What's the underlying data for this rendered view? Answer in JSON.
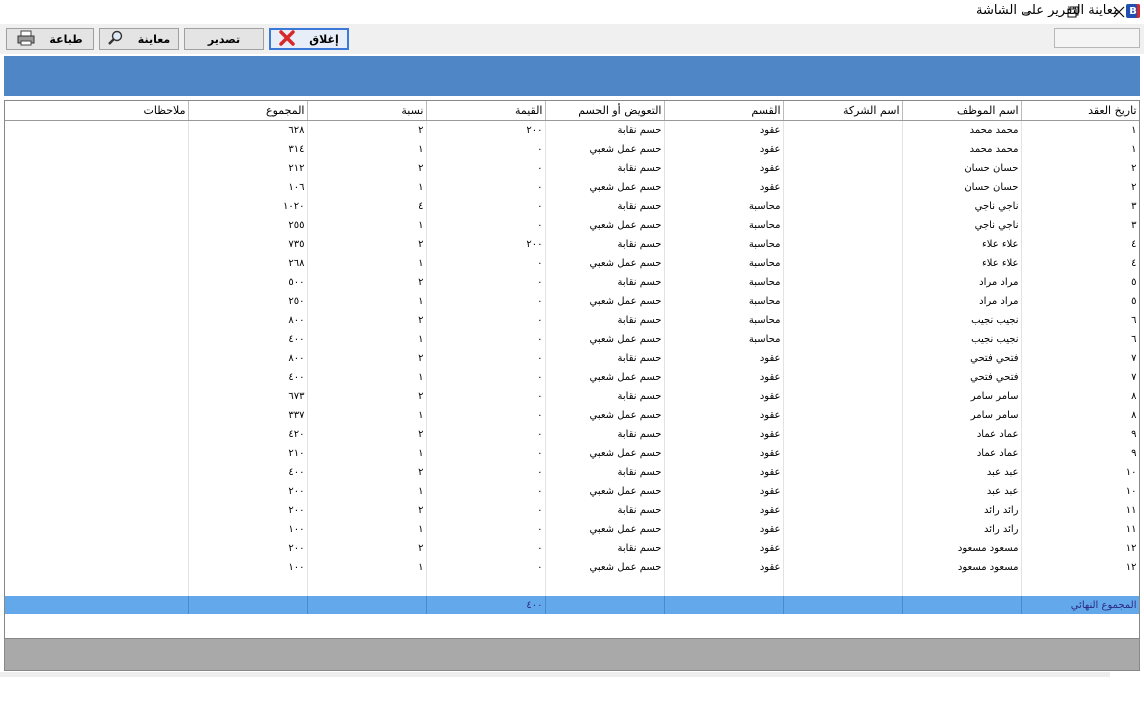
{
  "window": {
    "title": "معاينة التقرير على الشاشة",
    "app_icon_letter": "B"
  },
  "toolbar": {
    "print_label": "طباعة",
    "preview_label": "معاينة",
    "export_label": "تصدير",
    "close_label": "إغلاق"
  },
  "colors": {
    "banner": "#4f86c6",
    "total_row": "#64a8ec",
    "footer": "#a9a9a9",
    "close_icon": "#d8282a"
  },
  "table": {
    "headers": [
      "تاريخ العقد",
      "اسم الموظف",
      "اسم الشركة",
      "القسم",
      "التعويض أو الحسم",
      "القيمة",
      "نسبة",
      "المجموع",
      "ملاحظات"
    ],
    "rows": [
      [
        "١",
        "محمد محمد",
        "",
        "عقود",
        "حسم نقابة",
        "٢٠٠",
        "٢",
        "٦٢٨",
        ""
      ],
      [
        "١",
        "محمد محمد",
        "",
        "عقود",
        "حسم عمل شعبي",
        "٠",
        "١",
        "٣١٤",
        ""
      ],
      [
        "٢",
        "حسان حسان",
        "",
        "عقود",
        "حسم نقابة",
        "٠",
        "٢",
        "٢١٢",
        ""
      ],
      [
        "٢",
        "حسان حسان",
        "",
        "عقود",
        "حسم عمل شعبي",
        "٠",
        "١",
        "١٠٦",
        ""
      ],
      [
        "٣",
        "ناجي ناجي",
        "",
        "محاسبة",
        "حسم نقابة",
        "٠",
        "٤",
        "١٠٢٠",
        ""
      ],
      [
        "٣",
        "ناجي ناجي",
        "",
        "محاسبة",
        "حسم عمل شعبي",
        "٠",
        "١",
        "٢٥٥",
        ""
      ],
      [
        "٤",
        "علاء علاء",
        "",
        "محاسبة",
        "حسم نقابة",
        "٢٠٠",
        "٢",
        "٧٣٥",
        ""
      ],
      [
        "٤",
        "علاء علاء",
        "",
        "محاسبة",
        "حسم عمل شعبي",
        "٠",
        "١",
        "٢٦٨",
        ""
      ],
      [
        "٥",
        "مراد مراد",
        "",
        "محاسبة",
        "حسم نقابة",
        "٠",
        "٢",
        "٥٠٠",
        ""
      ],
      [
        "٥",
        "مراد مراد",
        "",
        "محاسبة",
        "حسم عمل شعبي",
        "٠",
        "١",
        "٢٥٠",
        ""
      ],
      [
        "٦",
        "نجيب نجيب",
        "",
        "محاسبة",
        "حسم نقابة",
        "٠",
        "٢",
        "٨٠٠",
        ""
      ],
      [
        "٦",
        "نجيب نجيب",
        "",
        "محاسبة",
        "حسم عمل شعبي",
        "٠",
        "١",
        "٤٠٠",
        ""
      ],
      [
        "٧",
        "فتحي فتحي",
        "",
        "عقود",
        "حسم نقابة",
        "٠",
        "٢",
        "٨٠٠",
        ""
      ],
      [
        "٧",
        "فتحي فتحي",
        "",
        "عقود",
        "حسم عمل شعبي",
        "٠",
        "١",
        "٤٠٠",
        ""
      ],
      [
        "٨",
        "سامر سامر",
        "",
        "عقود",
        "حسم نقابة",
        "٠",
        "٢",
        "٦٧٣",
        ""
      ],
      [
        "٨",
        "سامر سامر",
        "",
        "عقود",
        "حسم عمل شعبي",
        "٠",
        "١",
        "٣٣٧",
        ""
      ],
      [
        "٩",
        "عماد عماد",
        "",
        "عقود",
        "حسم نقابة",
        "٠",
        "٢",
        "٤٢٠",
        ""
      ],
      [
        "٩",
        "عماد عماد",
        "",
        "عقود",
        "حسم عمل شعبي",
        "٠",
        "١",
        "٢١٠",
        ""
      ],
      [
        "١٠",
        "عبد عبد",
        "",
        "عقود",
        "حسم نقابة",
        "٠",
        "٢",
        "٤٠٠",
        ""
      ],
      [
        "١٠",
        "عبد عبد",
        "",
        "عقود",
        "حسم عمل شعبي",
        "٠",
        "١",
        "٢٠٠",
        ""
      ],
      [
        "١١",
        "رائد رائد",
        "",
        "عقود",
        "حسم نقابة",
        "٠",
        "٢",
        "٢٠٠",
        ""
      ],
      [
        "١١",
        "رائد رائد",
        "",
        "عقود",
        "حسم عمل شعبي",
        "٠",
        "١",
        "١٠٠",
        ""
      ],
      [
        "١٢",
        "مسعود مسعود",
        "",
        "عقود",
        "حسم نقابة",
        "٠",
        "٢",
        "٢٠٠",
        ""
      ],
      [
        "١٢",
        "مسعود مسعود",
        "",
        "عقود",
        "حسم عمل شعبي",
        "٠",
        "١",
        "١٠٠",
        ""
      ]
    ],
    "total_label": "المجموع النهائي",
    "total_value": "٤٠٠"
  }
}
